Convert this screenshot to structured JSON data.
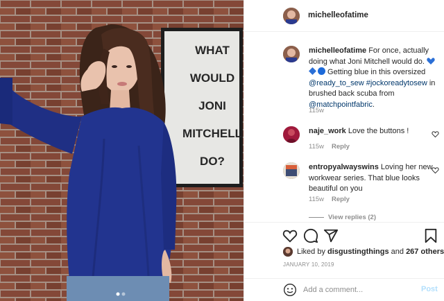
{
  "post": {
    "username": "michelleofatime",
    "poster_text_lines": [
      "WHAT",
      "WOULD",
      "JONI",
      "MITCHELL",
      "DO?"
    ]
  },
  "caption": {
    "username": "michelleofatime",
    "text_1": " For once, actually doing what Joni Mitchell would do. ",
    "text_2": " Getting blue in this oversized ",
    "tag_1": "@ready_to_sew",
    "tag_2": "#jockoreadytosew",
    "text_3": " in brushed back scuba from ",
    "tag_3": "@matchpointfabric",
    "text_4": ".",
    "time": "115w",
    "emoji": [
      "blue-heart",
      "blue-diamond",
      "blue-circle"
    ]
  },
  "comments": [
    {
      "username": "naje_work",
      "text": " Love the buttons !",
      "time": "115w",
      "reply_label": "Reply"
    },
    {
      "username": "entropyalwayswins",
      "text": " Loving her new workwear series. That blue looks beautiful on you",
      "time": "115w",
      "reply_label": "Reply"
    }
  ],
  "view_replies": "View replies (2)",
  "likes": {
    "prefix": "Liked by ",
    "user": "disgustingthings",
    "middle": " and ",
    "others": "267 others"
  },
  "date": "JANUARY 10, 2019",
  "add_comment": {
    "placeholder": "Add a comment...",
    "post_label": "Post"
  },
  "colors": {
    "link": "#00376b",
    "muted": "#8e8e8e",
    "post_disabled": "#b2dffc",
    "shirt": "#22348f"
  }
}
